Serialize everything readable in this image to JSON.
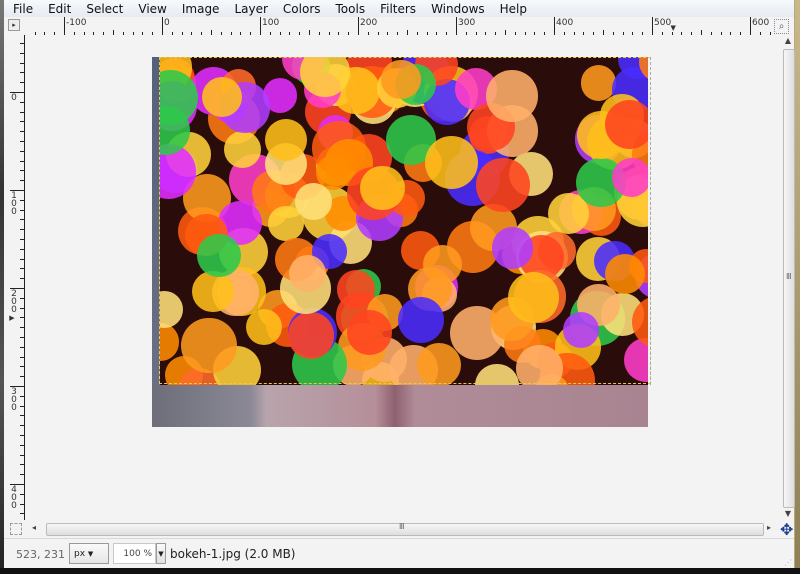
{
  "menubar": {
    "items": [
      "File",
      "Edit",
      "Select",
      "View",
      "Image",
      "Layer",
      "Colors",
      "Tools",
      "Filters",
      "Windows",
      "Help"
    ]
  },
  "rulers": {
    "horizontal_labels": [
      "-100",
      "0",
      "100",
      "200",
      "300",
      "400",
      "500",
      "600"
    ],
    "vertical_labels": [
      "0",
      "100",
      "200",
      "300",
      "400"
    ]
  },
  "icons": {
    "navigate": "▸",
    "zoom_fit": "⌕",
    "scroll_up": "▲",
    "scroll_down": "▼",
    "scroll_left": "◂",
    "scroll_right": "▸",
    "grip": "Ⅲ",
    "navigation_move": "✥",
    "dropdown": "▼",
    "resize": "⋰"
  },
  "statusbar": {
    "pointer_coords": "523, 231",
    "unit": "px",
    "zoom": "100 %",
    "file_info": "bokeh-1.jpg (2.0 MB)"
  },
  "image": {
    "name": "bokeh-1.jpg",
    "selection_color": "#e8c94a"
  }
}
